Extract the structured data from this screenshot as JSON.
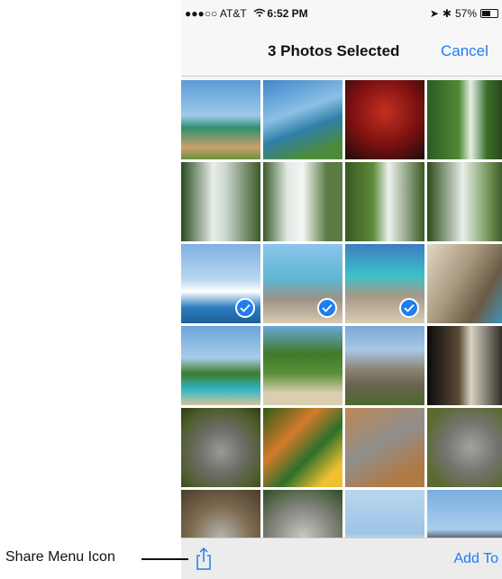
{
  "statusbar": {
    "carrier": "●●●○○ AT&T",
    "time": "6:52 PM",
    "battery": "57%",
    "battery_level": 0.57
  },
  "navbar": {
    "title": "3 Photos Selected",
    "cancel": "Cancel"
  },
  "photos": [
    {
      "name": "beach-palms"
    },
    {
      "name": "coastline"
    },
    {
      "name": "portrait-red"
    },
    {
      "name": "waterfall-green"
    },
    {
      "name": "waterfall-1"
    },
    {
      "name": "waterfall-2"
    },
    {
      "name": "waterfall-3"
    },
    {
      "name": "waterfall-4"
    },
    {
      "name": "cruise-ship",
      "selected": true
    },
    {
      "name": "driftwood-1",
      "selected": true
    },
    {
      "name": "driftwood-2",
      "selected": true
    },
    {
      "name": "carving"
    },
    {
      "name": "palm-lagoon"
    },
    {
      "name": "tree-beach"
    },
    {
      "name": "ruins"
    },
    {
      "name": "window-dark"
    },
    {
      "name": "koala-1"
    },
    {
      "name": "parrot"
    },
    {
      "name": "koala-2"
    },
    {
      "name": "koala-3"
    },
    {
      "name": "koala-4"
    },
    {
      "name": "koala-5"
    },
    {
      "name": "opera-house"
    },
    {
      "name": "harbour-bridge"
    }
  ],
  "toolbar": {
    "add_to": "Add To"
  },
  "callout": {
    "label": "Share Menu Icon"
  },
  "colors": {
    "accent": "#1f7cf1"
  }
}
